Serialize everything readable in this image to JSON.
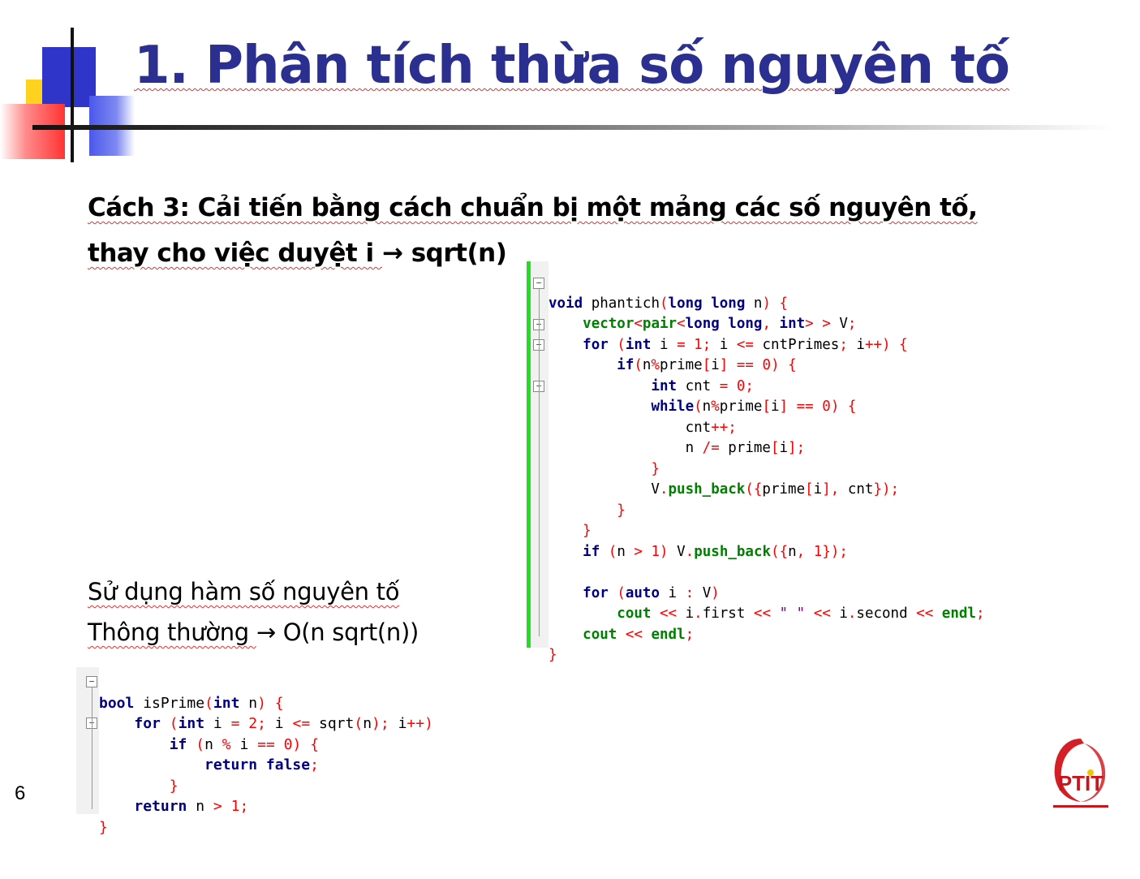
{
  "slide": {
    "title": "1. Phân tích thừa số nguyên tố",
    "line1": "Cách 3: Cải tiến bằng cách chuẩn bị một mảng các số nguyên tố,",
    "line2_prefix": "thay cho việc duyệt i ",
    "line2_arrow": "→",
    "line2_suffix": " sqrt(n)",
    "note1": "Sử dụng hàm số nguyên tố",
    "note2_prefix": "Thông thường ",
    "note2_arrow": "→",
    "note2_suffix": " O(n sqrt(n))",
    "page_number": "6",
    "logo_text": "PTIT"
  },
  "colors": {
    "title": "#2b2f8f",
    "keyword": "#0000ff",
    "type": "#008000",
    "number": "#ff0000",
    "green_bar": "#22dd22"
  },
  "code_phantich": [
    "void phantich(long long n) {",
    "    vector<pair<long long, int> > V;",
    "    for (int i = 1; i <= cntPrimes; i++) {",
    "        if(n%prime[i] == 0) {",
    "            int cnt = 0;",
    "            while(n%prime[i] == 0) {",
    "                cnt++;",
    "                n /= prime[i];",
    "            }",
    "            V.push_back({prime[i], cnt});",
    "        }",
    "    }",
    "    if (n > 1) V.push_back({n, 1});",
    "",
    "    for (auto i : V)",
    "        cout << i.first << \" \" << i.second << endl;",
    "    cout << endl;",
    "}"
  ],
  "code_isprime": [
    "bool isPrime(int n) {",
    "    for (int i = 2; i <= sqrt(n); i++)",
    "        if (n % i == 0) {",
    "            return false;",
    "        }",
    "    return n > 1;",
    "}"
  ]
}
